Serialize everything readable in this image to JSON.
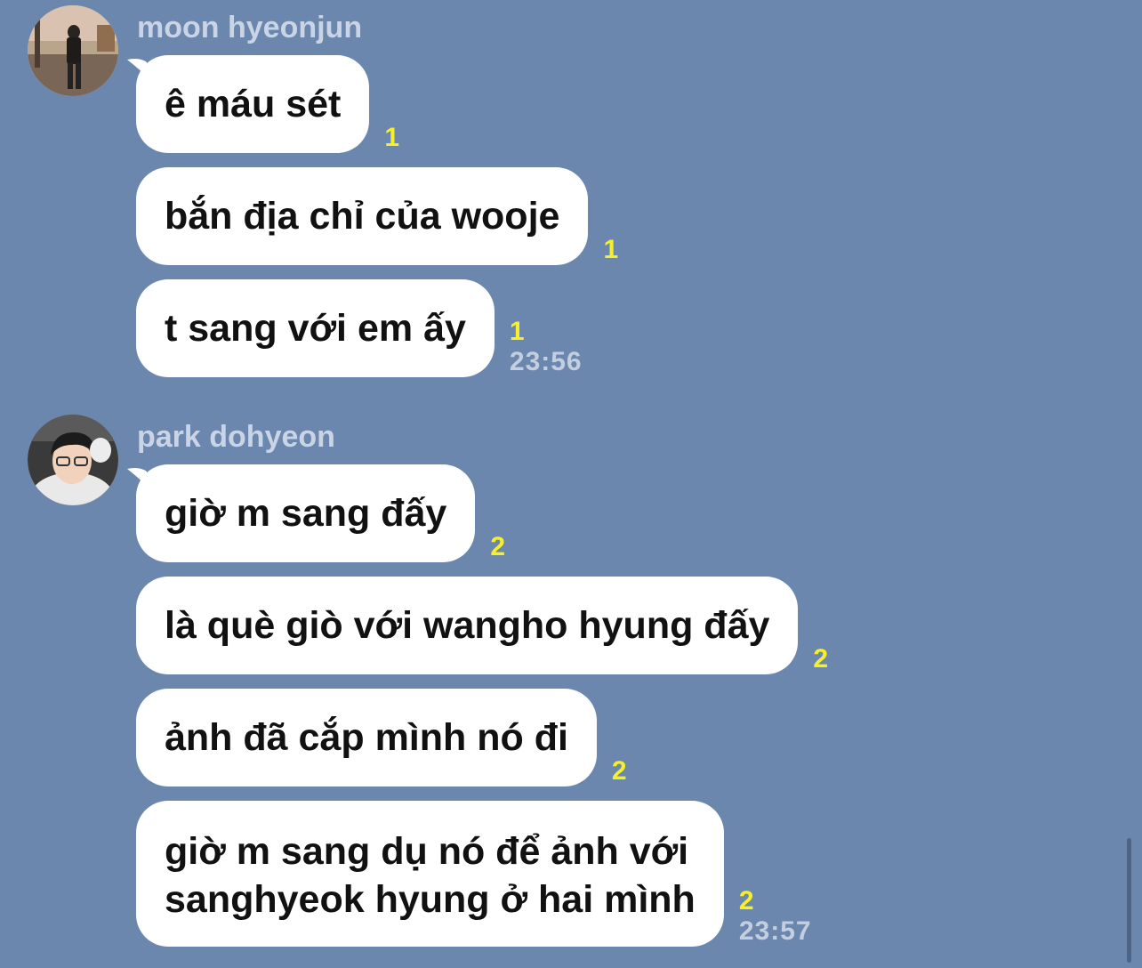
{
  "groups": [
    {
      "sender": "moon hyeonjun",
      "messages": [
        {
          "text": "ê máu sét",
          "unread": "1",
          "time": ""
        },
        {
          "text": "bắn địa chỉ của wooje",
          "unread": "1",
          "time": ""
        },
        {
          "text": "t sang với em ấy",
          "unread": "1",
          "time": "23:56"
        }
      ]
    },
    {
      "sender": "park dohyeon",
      "messages": [
        {
          "text": "giờ m sang đấy",
          "unread": "2",
          "time": ""
        },
        {
          "text": "là què giò với wangho hyung đấy",
          "unread": "2",
          "time": ""
        },
        {
          "text": "ảnh đã cắp mình nó đi",
          "unread": "2",
          "time": ""
        },
        {
          "text_line1": "giờ m sang dụ nó để ảnh với",
          "text_line2": "sanghyeok hyung ở hai mình",
          "unread": "2",
          "time": "23:57"
        }
      ]
    }
  ],
  "colors": {
    "background": "#6b87ad",
    "bubble": "#ffffff",
    "unread": "#f6f02a",
    "sender": "#c9d5e6"
  }
}
